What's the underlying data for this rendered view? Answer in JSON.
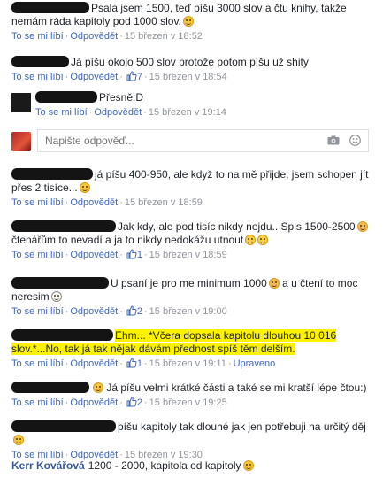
{
  "actions": {
    "like": "To se mi líbí",
    "reply": "Odpovědět",
    "edited": "Upraveno"
  },
  "composer": {
    "placeholder": "Napište odpověď..."
  },
  "comments": [
    {
      "text": "Psala jsem 1500, teď píšu 3000 slov a čtu knihy, takže",
      "text2": "nemám ráda kapitoly pod 1000 slov.",
      "likes": "",
      "time": "15 březen v 18:52"
    },
    {
      "name_partial": "",
      "text": "Já píšu okolo 500 slov protože potom píšu už shity",
      "likes": "7",
      "time": "15 březen v 18:54"
    },
    {
      "text": "Přesně:D",
      "likes": "",
      "time": "15 březen v 19:14"
    },
    {
      "text": "já píšu 400-950, ale když to na mě přijde, jsem schopen jít",
      "text2": "přes 2 tisíce...",
      "likes": "",
      "time": "15 březen v 18:59"
    },
    {
      "text": "Jak kdy, ale pod tisíc nikdy nejdu.. Spis 1500-2500",
      "text2": "čtenářům to nevadí a ja to nikdy nedokážu utnout",
      "likes": "1",
      "time": "15 březen v 18:59"
    },
    {
      "text": "U psaní je pro me minimum 1000",
      "text_b": "a u čtení to moc",
      "text2": "neresim",
      "likes": "2",
      "time": "15 březen v 19:00"
    },
    {
      "text": "Ehm... *Včera dopsala kapitolu dlouhou 10 016",
      "text2": "slov.*...No, tak já tak nějak dávám přednost spíš těm delším.",
      "likes": "1",
      "time": "15 březen v 19:11"
    },
    {
      "text": "Já píšu velmi krátké části a také se mi kratší lépe čtou:)",
      "likes": "2",
      "time": "15 březen v 19:25"
    },
    {
      "text": "píšu kapitoly tak dlouhé jak jen potřebuji na určitý děj",
      "likes": "",
      "time": "15 březen v 19:30"
    },
    {
      "name": "Kerr Kovářová",
      "text": "1200 - 2000, kapitola od kapitoly"
    }
  ]
}
